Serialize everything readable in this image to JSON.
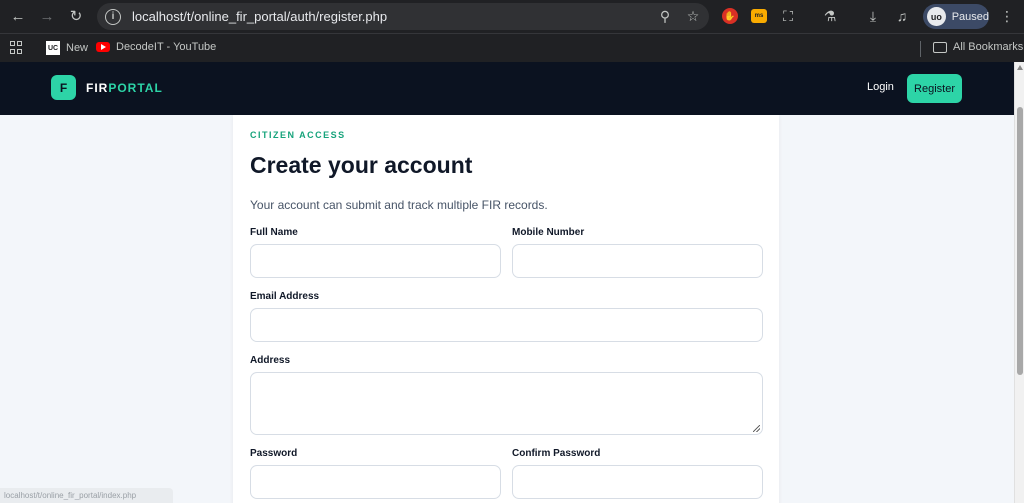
{
  "browser": {
    "url": "localhost/t/online_fir_portal/auth/register.php",
    "profile_status": "Paused",
    "profile_initials": "uo",
    "ext_yellow_text": "ms",
    "bookmarks": [
      {
        "label": "New"
      },
      {
        "label": "DecodeIT - YouTube"
      }
    ],
    "all_bookmarks_label": "All Bookmarks",
    "status_url": "localhost/t/online_fir_portal/index.php"
  },
  "site": {
    "brand_badge": "F",
    "brand_part1": "FIR",
    "brand_part2": "PORTAL",
    "nav_login": "Login",
    "nav_register": "Register",
    "accent_color": "#2dd4a7",
    "navbar_color": "#0b1220"
  },
  "form": {
    "eyebrow": "CITIZEN ACCESS",
    "title": "Create your account",
    "subtitle": "Your account can submit and track multiple FIR records.",
    "fields": {
      "full_name": {
        "label": "Full Name",
        "value": ""
      },
      "mobile": {
        "label": "Mobile Number",
        "value": ""
      },
      "email": {
        "label": "Email Address",
        "value": ""
      },
      "address": {
        "label": "Address",
        "value": ""
      },
      "password": {
        "label": "Password",
        "value": ""
      },
      "confirm_password": {
        "label": "Confirm Password",
        "value": ""
      }
    }
  }
}
